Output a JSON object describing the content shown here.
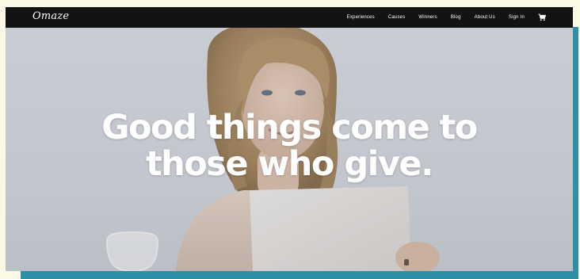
{
  "brand": {
    "logo_text": "Omaze"
  },
  "nav": {
    "items": [
      {
        "label": "Experiences"
      },
      {
        "label": "Causes"
      },
      {
        "label": "Winners"
      },
      {
        "label": "Blog"
      },
      {
        "label": "About Us"
      },
      {
        "label": "Sign In"
      }
    ],
    "cart_icon": "shopping-cart-icon"
  },
  "hero": {
    "headline_line1": "Good things come to",
    "headline_line2": "those who give."
  },
  "colors": {
    "nav_bg": "#131313",
    "nav_text": "#ffffff",
    "headline": "#ffffff",
    "accent_shadow": "#2e8fa6",
    "page_bg": "#fbf8e6"
  }
}
